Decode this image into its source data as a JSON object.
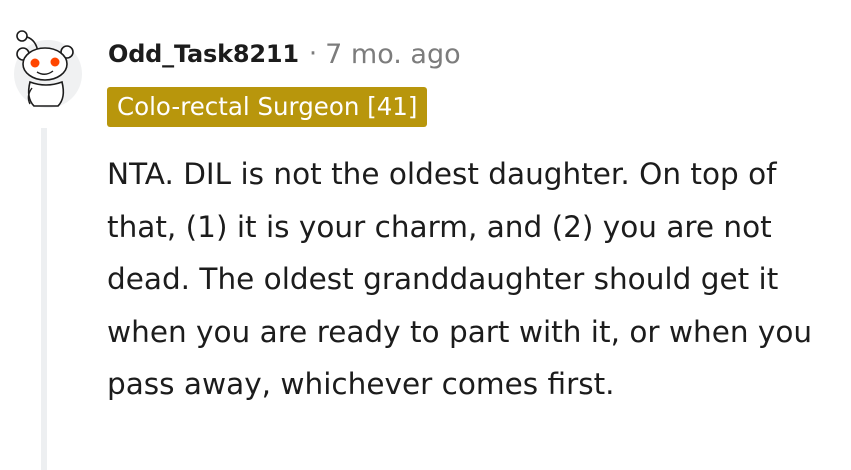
{
  "comment": {
    "author": "Odd_Task8211",
    "separator": "·",
    "timestamp": "7 mo. ago",
    "flair": "Colo-rectal Surgeon [41]",
    "body": "NTA. DIL is not the oldest daughter. On top of that, (1) it is your charm, and (2) you are not dead. The oldest granddaughter should get it when you are ready to part with it, or when you pass away, whichever comes first."
  },
  "avatar": {
    "icon": "snoo-icon",
    "eye_color": "#ff4500"
  },
  "colors": {
    "flair_background": "#b8960c",
    "flair_text": "#ffffff",
    "meta_text": "#7c7c7c",
    "body_text": "#1c1c1c",
    "thread_line": "#edeff1"
  }
}
